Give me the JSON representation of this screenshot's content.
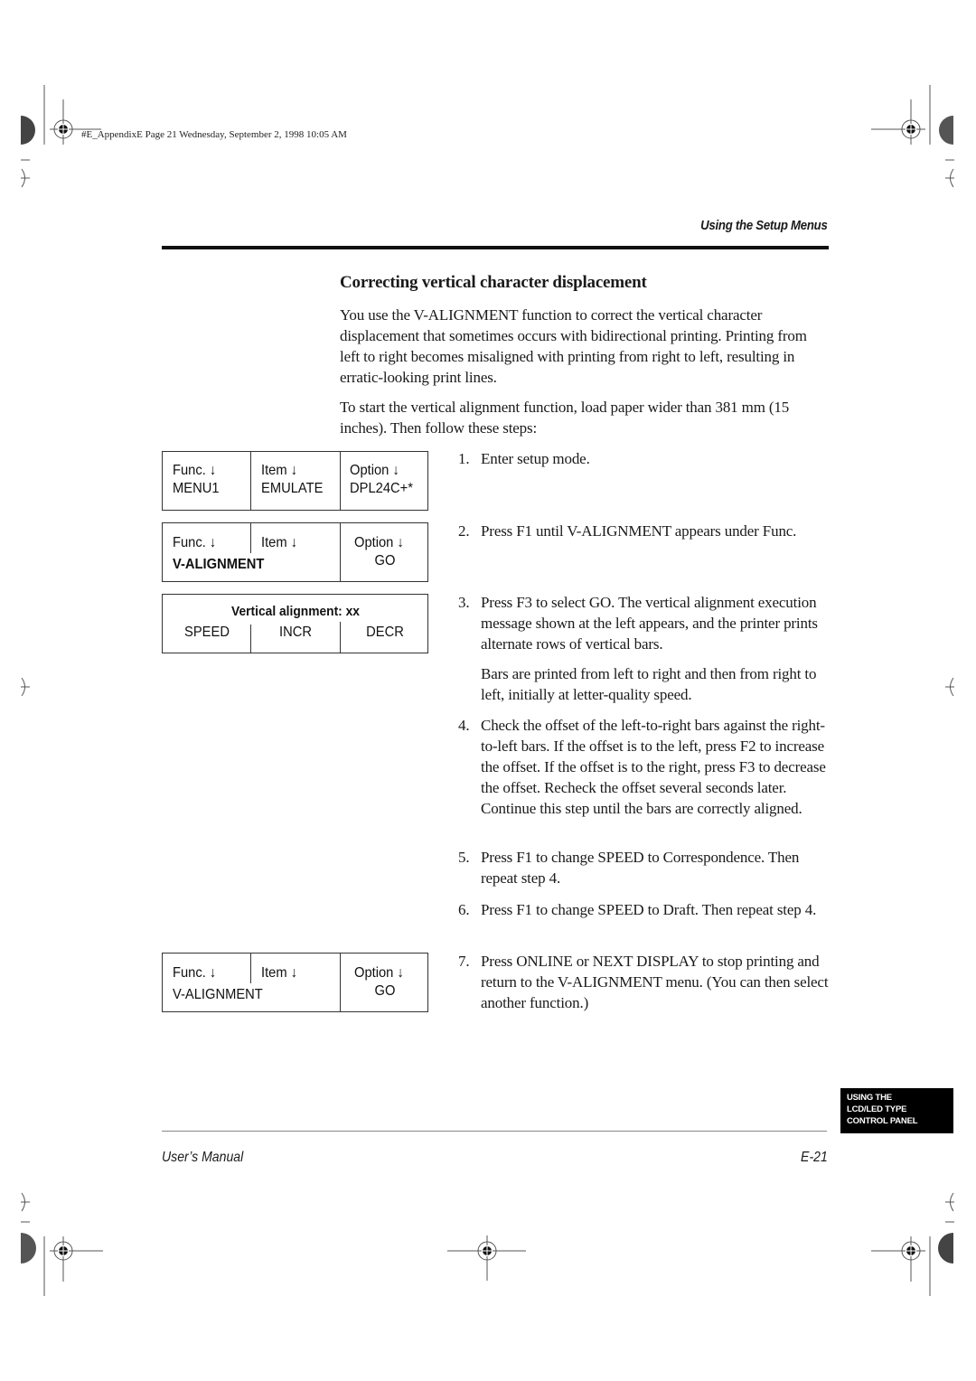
{
  "slug": "#E_AppendixE  Page 21  Wednesday, September 2, 1998  10:05 AM",
  "header": {
    "running_head": "Using the Setup Menus"
  },
  "section": {
    "title": "Correcting vertical character displacement",
    "intro_paragraphs": [
      "You use the V-ALIGNMENT function to correct the vertical character displacement that sometimes occurs with bidirectional printing. Printing from left to right becomes misaligned with printing from right to left, resulting in erratic-looking print lines.",
      "To start the vertical alignment function, load paper wider than 381 mm (15 inches). Then follow these steps:"
    ],
    "steps": [
      {
        "num": "1.",
        "text": "Enter setup mode."
      },
      {
        "num": "2.",
        "text": "Press F1 until V-ALIGNMENT appears under Func."
      },
      {
        "num": "3.",
        "text": "Press F3 to select GO. The vertical alignment execution message shown at the left appears, and the printer prints alternate rows of vertical bars.",
        "note": "Bars are printed from left to right and then from right to left, initially at letter-quality speed."
      },
      {
        "num": "4.",
        "text": "Check the offset of the left-to-right bars against the right-to-left bars. If the offset is to the left, press F2 to increase the offset. If the offset is to the right, press F3 to decrease the offset. Recheck the offset several seconds later. Continue this step until the bars are correctly aligned."
      },
      {
        "num": "5.",
        "text": "Press F1 to change SPEED to Correspondence. Then repeat step 4."
      },
      {
        "num": "6.",
        "text": "Press F1 to change SPEED to Draft. Then repeat step 4."
      },
      {
        "num": "7.",
        "text": "Press ONLINE or NEXT DISPLAY to stop printing and return to the V-ALIGNMENT menu. (You can then select another function.)"
      }
    ]
  },
  "lcd_panels": [
    {
      "func_label": "Func. ↓",
      "item_label": "Item ↓",
      "option_label": "Option ↓",
      "func_value": "MENU1",
      "item_value": "EMULATE",
      "option_value": "DPL24C+*"
    },
    {
      "func_label": "Func. ↓",
      "item_label": "Item ↓",
      "option_label": "Option ↓",
      "func_value": "V-ALIGNMENT",
      "option_value": "GO"
    },
    {
      "message": "Vertical alignment: xx",
      "keys": [
        "SPEED",
        "INCR",
        "DECR"
      ]
    },
    {
      "func_label": "Func. ↓",
      "item_label": "Item ↓",
      "option_label": "Option ↓",
      "func_value": "V-ALIGNMENT",
      "option_value": "GO"
    }
  ],
  "chapter_tab": {
    "lines": [
      "USING THE",
      "LCD/LED TYPE",
      "CONTROL PANEL"
    ]
  },
  "footer": {
    "left": "User’s Manual",
    "right": "E-21"
  }
}
